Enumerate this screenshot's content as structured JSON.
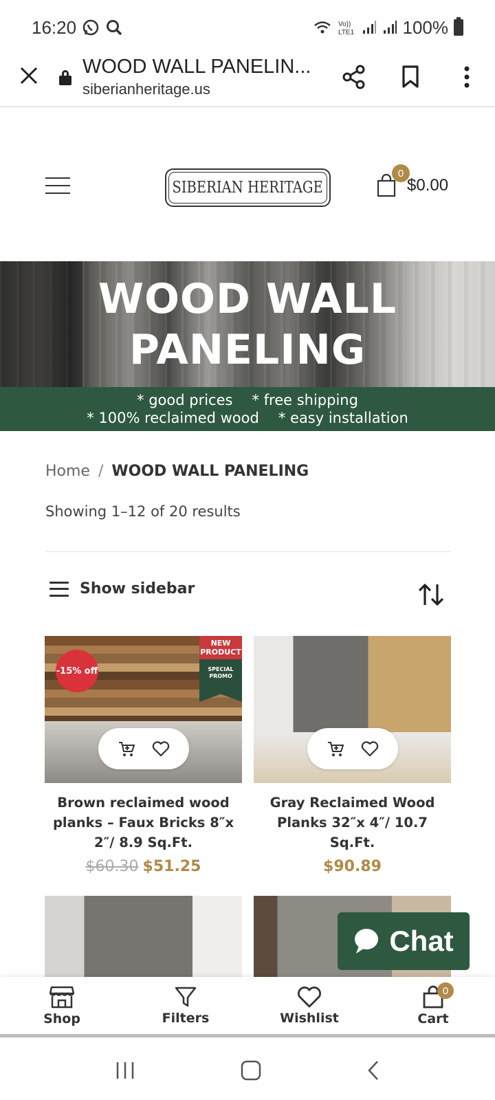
{
  "status_bar": {
    "time": "16:20",
    "battery": "100%",
    "icons": [
      "whatsapp-icon",
      "search-icon",
      "wifi-icon",
      "volte-icon",
      "signal-icon",
      "signal-icon",
      "battery-icon"
    ]
  },
  "browser": {
    "page_title": "WOOD WALL PANELIN...",
    "domain": "siberianheritage.us"
  },
  "header": {
    "logo_text": "SIBERIAN HERITAGE",
    "cart_count": "0",
    "cart_total": "$0.00"
  },
  "banner": {
    "title_line1": "WOOD WALL",
    "title_line2": "PANELING",
    "features_row1": [
      "* good prices",
      "* free shipping"
    ],
    "features_row2": [
      "* 100% reclaimed wood",
      "* easy installation"
    ]
  },
  "breadcrumb": {
    "home": "Home",
    "separator": "/",
    "current": "WOOD WALL PANELING"
  },
  "results": "Showing 1–12 of 20 results",
  "toolbar": {
    "sidebar_label": "Show sidebar"
  },
  "products": [
    {
      "name": "Brown reclaimed wood planks – Faux Bricks 8″x 2″/ 8.9 Sq.Ft.",
      "old_price": "$60.30",
      "price": "$51.25",
      "discount_badge": "-15% off",
      "ribbon_top": "NEW PRODUCT",
      "ribbon_bottom": "SPECIAL PROMO"
    },
    {
      "name": "Gray Reclaimed Wood Planks 32″x 4″/ 10.7 Sq.Ft.",
      "price": "$90.89"
    }
  ],
  "chat": {
    "label": "Chat"
  },
  "bottom_nav": {
    "items": [
      {
        "label": "Shop",
        "icon": "shop-icon"
      },
      {
        "label": "Filters",
        "icon": "filter-icon"
      },
      {
        "label": "Wishlist",
        "icon": "heart-icon"
      },
      {
        "label": "Cart",
        "icon": "cart-icon",
        "badge": "0"
      }
    ]
  },
  "colors": {
    "accent_green": "#2e5940",
    "price_gold": "#b08a48",
    "discount_red": "#d9323a"
  }
}
